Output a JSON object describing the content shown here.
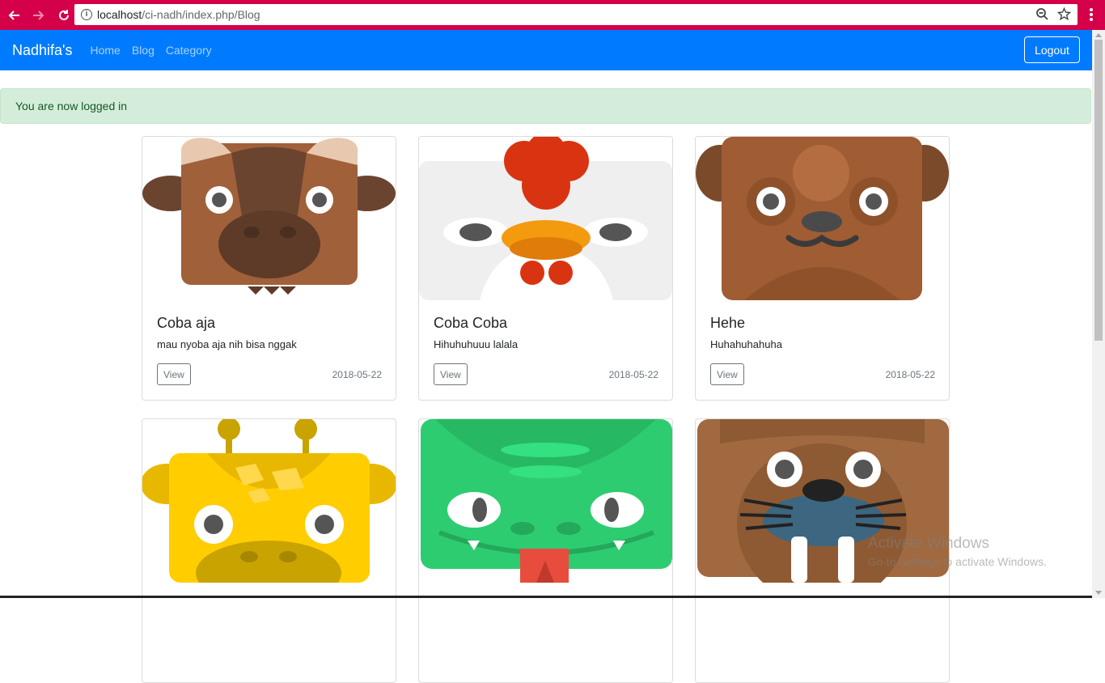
{
  "browser": {
    "url_host": "localhost",
    "url_path": "/ci-nadh/index.php/Blog",
    "chrome_color": "#d4004a"
  },
  "navbar": {
    "brand": "Nadhifa's",
    "links": [
      "Home",
      "Blog",
      "Category"
    ],
    "logout_label": "Logout",
    "color": "#007bff"
  },
  "alert": {
    "message": "You are now logged in"
  },
  "posts": [
    {
      "title": "Coba aja",
      "body": "mau nyoba aja nih bisa nggak",
      "button": "View",
      "date": "2018-05-22",
      "image": "buffalo-icon"
    },
    {
      "title": "Coba Coba",
      "body": "Hihuhuhuuu lalala",
      "button": "View",
      "date": "2018-05-22",
      "image": "chicken-icon"
    },
    {
      "title": "Hehe",
      "body": "Huhahuhahuha",
      "button": "View",
      "date": "2018-05-22",
      "image": "beaver-icon"
    },
    {
      "image": "giraffe-icon"
    },
    {
      "image": "crocodile-icon"
    },
    {
      "image": "walrus-icon"
    }
  ],
  "watermark": {
    "line1": "Activate Windows",
    "line2": "Go to Settings to activate Windows."
  }
}
